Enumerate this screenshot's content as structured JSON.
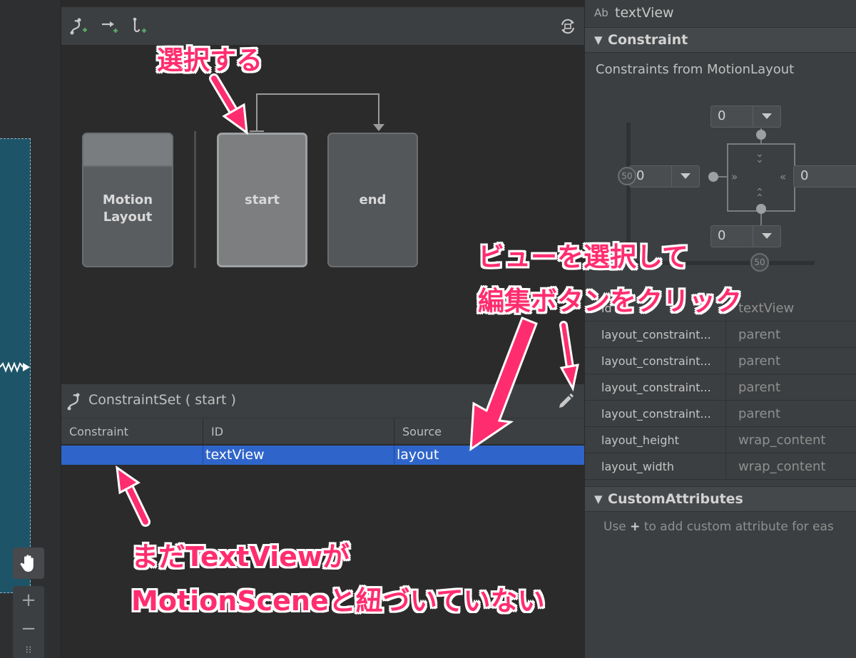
{
  "colors": {
    "accent_pink": "#ff2d6f",
    "selection_blue": "#2f65ca",
    "panel_bg": "#3c3f41",
    "blueprint_bg": "#1e5468"
  },
  "canvas": {
    "hand_tool_icon": "hand-icon",
    "zoom_in": "+",
    "zoom_out": "−",
    "fit": "⁝⁝"
  },
  "overview": {
    "toolbar_icons": [
      "create-transition-icon",
      "create-click-handler-icon",
      "create-constraint-set-icon",
      "cycle-layout-icon"
    ],
    "cards": {
      "motion_layout": "Motion\nLayout",
      "start": "start",
      "end": "end"
    }
  },
  "constraint_set": {
    "title": "ConstraintSet ( start )",
    "columns": [
      "Constraint",
      "ID",
      "Source"
    ],
    "rows": [
      {
        "constraint": "",
        "id": "textView",
        "source": "layout"
      }
    ]
  },
  "attributes": {
    "type_badge": "Ab",
    "title": "textView",
    "constraint_section": "Constraint",
    "constraints_from": "Constraints from MotionLayout",
    "margins": {
      "top": "0",
      "left": "0",
      "right": "0",
      "bottom": "0"
    },
    "bias": {
      "vertical": "50",
      "horizontal": "50"
    },
    "table": [
      {
        "key": "id",
        "value": "textView"
      },
      {
        "key": "layout_constraint...",
        "value": "parent"
      },
      {
        "key": "layout_constraint...",
        "value": "parent"
      },
      {
        "key": "layout_constraint...",
        "value": "parent"
      },
      {
        "key": "layout_constraint...",
        "value": "parent"
      },
      {
        "key": "layout_height",
        "value": "wrap_content"
      },
      {
        "key": "layout_width",
        "value": "wrap_content"
      }
    ],
    "custom_section": "CustomAttributes",
    "custom_help_prefix": "Use ",
    "custom_help_plus": "+",
    "custom_help_suffix": " to add custom attribute for eas"
  },
  "annotations": {
    "select": "選択する",
    "select_view_line1": "ビューを選択して",
    "select_view_line2": "編集ボタンをクリック",
    "not_linked_line1": "まだTextViewが",
    "not_linked_line2": "MotionSceneと紐づいていない"
  }
}
